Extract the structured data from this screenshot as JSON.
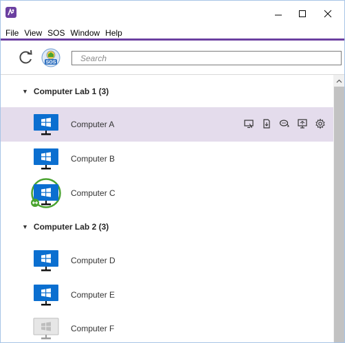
{
  "menu": [
    "File",
    "View",
    "SOS",
    "Window",
    "Help"
  ],
  "window_controls": {
    "minimize": "minimize-icon",
    "maximize": "maximize-icon",
    "close": "close-icon"
  },
  "toolbar": {
    "search_placeholder": "Search",
    "sos_label": "SOS"
  },
  "colors": {
    "accent": "#6b3fa0",
    "selected_row": "#e4dcec",
    "monitor": "#0b6fd0",
    "disabled_monitor": "#bdbdbd",
    "online_ring": "#4aa32f"
  },
  "groups": [
    {
      "label": "Computer Lab 1 (3)",
      "computers": [
        {
          "name": "Computer A",
          "selected": true,
          "status": "normal"
        },
        {
          "name": "Computer B",
          "selected": false,
          "status": "normal"
        },
        {
          "name": "Computer C",
          "selected": false,
          "status": "remote-controlled"
        }
      ]
    },
    {
      "label": "Computer Lab 2 (3)",
      "computers": [
        {
          "name": "Computer D",
          "selected": false,
          "status": "normal"
        },
        {
          "name": "Computer E",
          "selected": false,
          "status": "normal"
        },
        {
          "name": "Computer F",
          "selected": false,
          "status": "offline"
        }
      ]
    }
  ],
  "row_actions": [
    "remote-view-icon",
    "file-transfer-icon",
    "chat-icon",
    "screen-share-icon",
    "settings-gear-icon"
  ]
}
